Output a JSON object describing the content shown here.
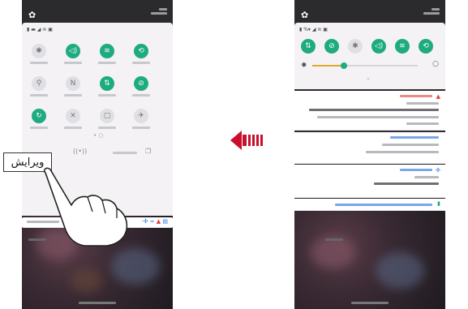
{
  "callout": {
    "text": "ويرايش"
  },
  "left_phone": {
    "gear_icon": "gear-icon",
    "page_dots": "• ○",
    "tiles": [
      {
        "icon": "bluetooth-icon",
        "state": "off",
        "glyph": "✱"
      },
      {
        "icon": "sound-icon",
        "state": "on",
        "glyph": "◁)"
      },
      {
        "icon": "wifi-icon",
        "state": "on",
        "glyph": "≋"
      },
      {
        "icon": "rotate-icon",
        "state": "on",
        "glyph": "⟲"
      },
      {
        "icon": "flashlight-icon",
        "state": "off",
        "glyph": "⚲"
      },
      {
        "icon": "nfc-icon",
        "state": "off",
        "glyph": "N"
      },
      {
        "icon": "data-icon",
        "state": "on",
        "glyph": "⇅"
      },
      {
        "icon": "block-icon",
        "state": "on",
        "glyph": "⊘"
      },
      {
        "icon": "sync-icon",
        "state": "on",
        "glyph": "↻"
      },
      {
        "icon": "mute-icon",
        "state": "off",
        "glyph": "✕"
      },
      {
        "icon": "screen-icon",
        "state": "off",
        "glyph": "▢"
      },
      {
        "icon": "airplane-icon",
        "state": "off",
        "glyph": "✈"
      }
    ],
    "bottom_icon_glyphs": [
      "((•))",
      "❐"
    ]
  },
  "right_phone": {
    "page_dots": "⌄",
    "tiles": [
      {
        "icon": "data-icon",
        "glyph": "⇅",
        "state": "on"
      },
      {
        "icon": "block-icon",
        "glyph": "⊘",
        "state": "on"
      },
      {
        "icon": "bluetooth-icon",
        "glyph": "✱",
        "state": "off"
      },
      {
        "icon": "sound-icon",
        "glyph": "◁)",
        "state": "on"
      },
      {
        "icon": "wifi-icon",
        "glyph": "≋",
        "state": "on"
      },
      {
        "icon": "rotate-icon",
        "glyph": "⟲",
        "state": "on"
      }
    ],
    "brightness_level": 0.3
  },
  "colors": {
    "accent": "#1dab7f",
    "arrow": "#c8102e",
    "alert": "#e53935"
  }
}
